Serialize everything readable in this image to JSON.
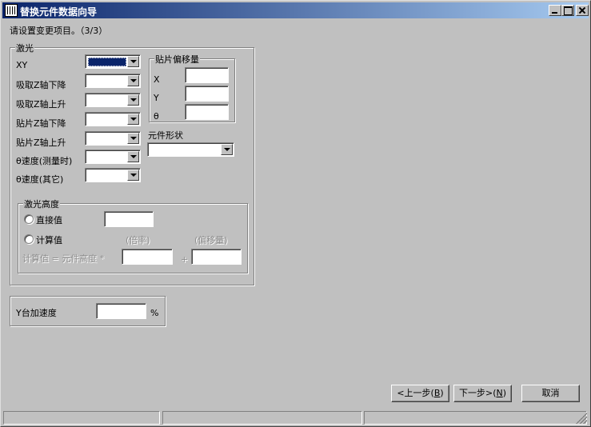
{
  "window": {
    "title": "替换元件数据向导"
  },
  "instruction": "请设置变更项目。（3/3）",
  "laser_group": {
    "title": "激光",
    "rows": [
      {
        "label": "XY"
      },
      {
        "label": "吸取Z轴下降"
      },
      {
        "label": "吸取Z轴上升"
      },
      {
        "label": "贴片Z轴下降"
      },
      {
        "label": "贴片Z轴上升"
      },
      {
        "label": "θ速度(测量时)"
      },
      {
        "label": "θ速度(其它)"
      }
    ]
  },
  "offset_group": {
    "title": "贴片偏移量",
    "x_label": "X",
    "y_label": "Y",
    "theta_label": "θ"
  },
  "shape": {
    "label": "元件形状"
  },
  "height_group": {
    "title": "激光高度",
    "direct_label": "直接值",
    "calc_label": "计算值",
    "rate_header": "(倍率)",
    "offset_header": "(偏移量)",
    "formula": "计算值 = 元件高度 *",
    "plus": "+"
  },
  "y_accel": {
    "label": "Y台加速度",
    "unit": "%"
  },
  "buttons": {
    "back": "<上一步",
    "back_key": "B",
    "next": "下一步>",
    "next_key": "N",
    "cancel": "取消"
  }
}
